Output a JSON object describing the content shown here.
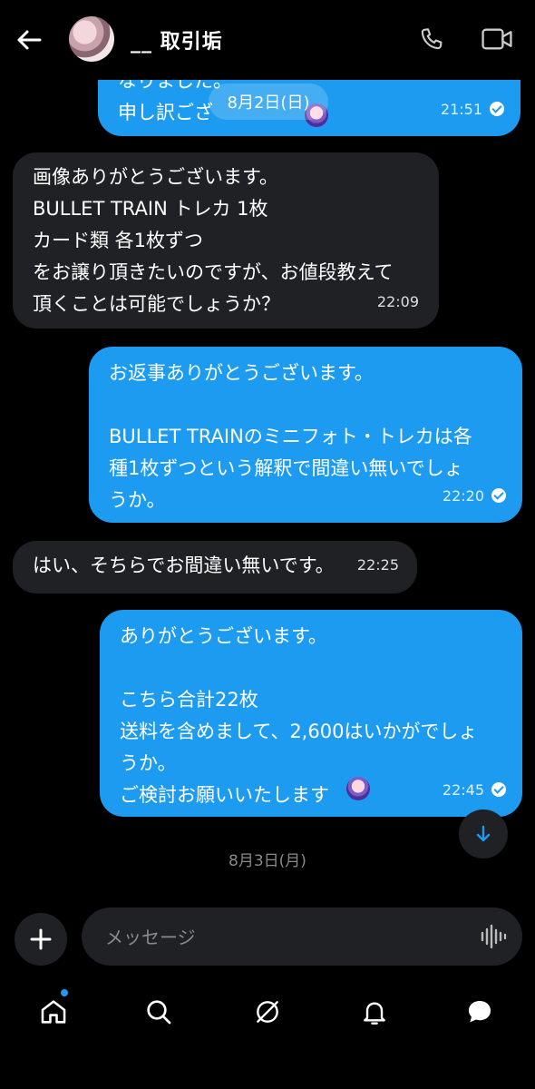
{
  "header": {
    "title": "__ 取引垢",
    "back_icon": "back-arrow-icon",
    "call_icon": "phone-icon",
    "video_icon": "video-icon"
  },
  "date_dividers": [
    "8月2日(日)",
    "8月3日(月)"
  ],
  "messages": [
    {
      "direction": "out",
      "text": "なりました。\n申し訳ござ",
      "time": "21:51",
      "status": "read"
    },
    {
      "direction": "in",
      "text": "画像ありがとうございます。\nBULLET TRAIN トレカ 1枚\nカード類 各1枚ずつ\nをお譲り頂きたいのですが、お値段教えて\n頂くことは可能でしょうか？",
      "time": "22:09"
    },
    {
      "direction": "out",
      "text": "お返事ありがとうございます。\n\nBULLET TRAINのミニフォト・トレカは各\n種1枚ずつという解釈で間違い無いでしょ\nうか。",
      "time": "22:20",
      "status": "read"
    },
    {
      "direction": "in",
      "text": "はい、そちらでお間違い無いです。",
      "time": "22:25"
    },
    {
      "direction": "out",
      "text": "ありがとうございます。\n\nこちら合計22枚\n送料を含めまして、2,600はいかがでしょ\nうか。\nご検討お願いいたします",
      "time": "22:45",
      "status": "read"
    }
  ],
  "composer": {
    "placeholder": "メッセージ"
  },
  "colors": {
    "outgoing": "#1d9bf0",
    "incoming": "#202124",
    "background": "#000000",
    "accent": "#1d9bf0"
  },
  "bottom_nav": [
    "home-icon",
    "search-icon",
    "grok-icon",
    "notifications-icon",
    "messages-icon"
  ]
}
